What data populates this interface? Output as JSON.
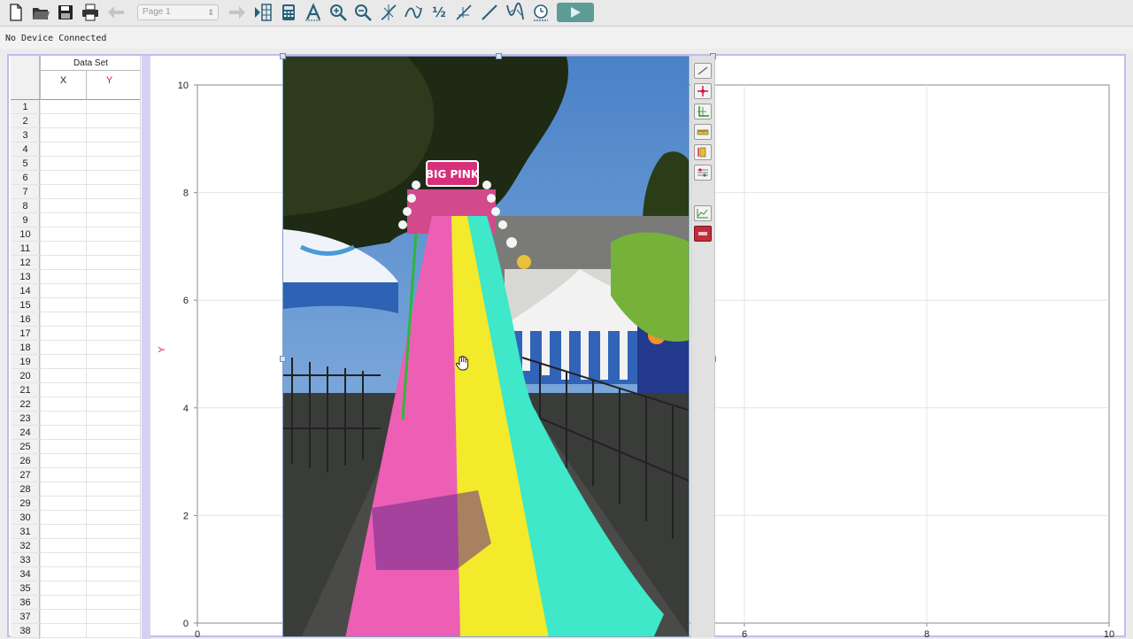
{
  "toolbar": {
    "page_select": "Page 1",
    "fraction_label": "½"
  },
  "status": {
    "text": "No Device Connected"
  },
  "table": {
    "dataset_title": "Data Set",
    "col_x": "X",
    "col_y": "Y",
    "row_numbers": [
      "1",
      "2",
      "3",
      "4",
      "5",
      "6",
      "7",
      "8",
      "9",
      "10",
      "11",
      "12",
      "13",
      "14",
      "15",
      "16",
      "17",
      "18",
      "19",
      "20",
      "21",
      "22",
      "23",
      "24",
      "25",
      "26",
      "27",
      "28",
      "29",
      "30",
      "31",
      "32",
      "33",
      "34",
      "35",
      "36",
      "37",
      "38"
    ]
  },
  "graph": {
    "y_label": "Y",
    "y_ticks": [
      "0",
      "2",
      "4",
      "6",
      "8",
      "10"
    ],
    "x_ticks_visible": [
      "0",
      "6",
      "8",
      "10"
    ]
  },
  "photo": {
    "sign_text": "BIG PINK"
  },
  "colors": {
    "accent": "#5c9c95",
    "workspace_border": "#c8b8ee",
    "y_column": "#d0143a",
    "slide_pink": "#ec5fb4",
    "slide_yellow": "#f4ea2c",
    "slide_teal": "#3ee8c8"
  }
}
